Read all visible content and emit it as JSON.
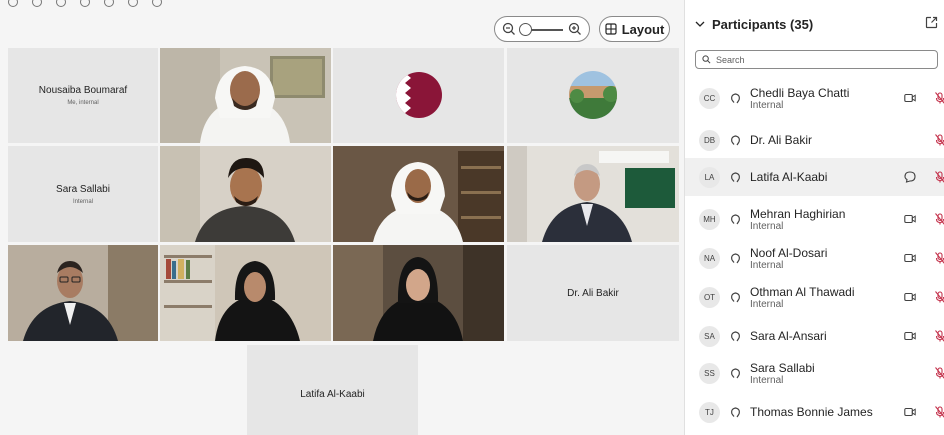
{
  "toolbar": {
    "layout_label": "Layout",
    "zoom_out_icon": "zoom-out-icon",
    "zoom_in_icon": "zoom-in-icon"
  },
  "tiles": [
    {
      "type": "label",
      "name": "Nousaiba Boumaraf",
      "sub": "Me, internal"
    },
    {
      "type": "video",
      "desc": "man-white-ghutra-office"
    },
    {
      "type": "avatar-image",
      "desc": "qatar-flag-avatar"
    },
    {
      "type": "avatar-image",
      "desc": "building-landscape-avatar"
    },
    {
      "type": "label",
      "name": "Sara Sallabi",
      "sub": "Internal"
    },
    {
      "type": "video",
      "desc": "young-man-dark-hair"
    },
    {
      "type": "video",
      "desc": "man-white-ghutra-shelves"
    },
    {
      "type": "video",
      "desc": "older-man-suit-office"
    },
    {
      "type": "video",
      "desc": "man-glasses-suit"
    },
    {
      "type": "video",
      "desc": "woman-black-abaya-bookshelf"
    },
    {
      "type": "video",
      "desc": "woman-black-abaya-lit"
    },
    {
      "type": "label",
      "name": "Dr. Ali Bakir",
      "sub": ""
    },
    {
      "type": "label",
      "name": "Latifa Al-Kaabi",
      "sub": ""
    }
  ],
  "panel": {
    "title": "Participants (35)",
    "search_placeholder": "Search",
    "participants": [
      {
        "initials": "CC",
        "name": "Chedli Baya Chatti",
        "sub": "Internal",
        "camera": true,
        "chat": false
      },
      {
        "initials": "DB",
        "name": "Dr. Ali Bakir",
        "sub": "",
        "camera": false,
        "chat": false
      },
      {
        "initials": "LA",
        "name": "Latifa Al-Kaabi",
        "sub": "",
        "camera": false,
        "chat": true
      },
      {
        "initials": "MH",
        "name": "Mehran Haghirian",
        "sub": "Internal",
        "camera": true,
        "chat": false
      },
      {
        "initials": "NA",
        "name": "Noof Al-Dosari",
        "sub": "Internal",
        "camera": true,
        "chat": false
      },
      {
        "initials": "OT",
        "name": "Othman Al Thawadi",
        "sub": "Internal",
        "camera": true,
        "chat": false
      },
      {
        "initials": "SA",
        "name": "Sara Al-Ansari",
        "sub": "",
        "camera": true,
        "chat": false
      },
      {
        "initials": "SS",
        "name": "Sara Sallabi",
        "sub": "Internal",
        "camera": false,
        "chat": false
      },
      {
        "initials": "TJ",
        "name": "Thomas Bonnie James",
        "sub": "",
        "camera": true,
        "chat": false
      }
    ]
  },
  "colors": {
    "tile_bg": "#e6e6e6",
    "mic_muted": "#c4314b",
    "highlight_row": "#f0f0f0"
  }
}
